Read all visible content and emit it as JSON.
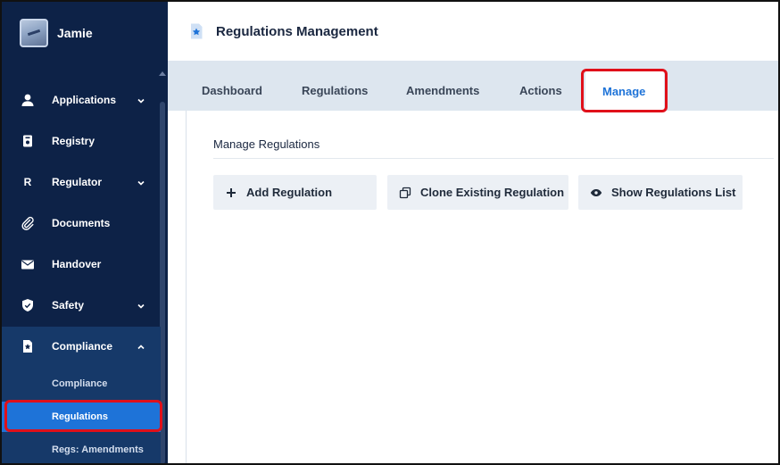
{
  "user": {
    "name": "Jamie"
  },
  "header": {
    "title": "Regulations Management",
    "icon": "star-document-icon"
  },
  "sidebar": {
    "items": [
      {
        "label": "Applications",
        "icon": "person-icon",
        "expandable": true
      },
      {
        "label": "Registry",
        "icon": "id-card-icon",
        "expandable": false
      },
      {
        "label": "Regulator",
        "icon": "R",
        "expandable": true
      },
      {
        "label": "Documents",
        "icon": "paperclip-icon",
        "expandable": false
      },
      {
        "label": "Handover",
        "icon": "envelope-icon",
        "expandable": false
      },
      {
        "label": "Safety",
        "icon": "shield-icon",
        "expandable": true
      },
      {
        "label": "Compliance",
        "icon": "star-document-icon",
        "expandable": true,
        "expanded": true
      }
    ],
    "subitems": [
      {
        "label": "Compliance"
      },
      {
        "label": "Regulations",
        "selected": true
      },
      {
        "label": "Regs: Amendments"
      }
    ]
  },
  "tabs": [
    {
      "label": "Dashboard"
    },
    {
      "label": "Regulations"
    },
    {
      "label": "Amendments"
    },
    {
      "label": "Actions"
    },
    {
      "label": "Manage",
      "active": true
    }
  ],
  "main": {
    "section_title": "Manage Regulations",
    "buttons": [
      {
        "label": "Add Regulation",
        "icon": "plus-icon"
      },
      {
        "label": "Clone Existing Regulation",
        "icon": "copy-icon"
      },
      {
        "label": "Show Regulations List",
        "icon": "eye-icon"
      }
    ]
  },
  "colors": {
    "sidebar_bg": "#0d2247",
    "accent": "#1e73d8",
    "highlight": "#e0101a",
    "tab_band": "#dde6ef"
  }
}
